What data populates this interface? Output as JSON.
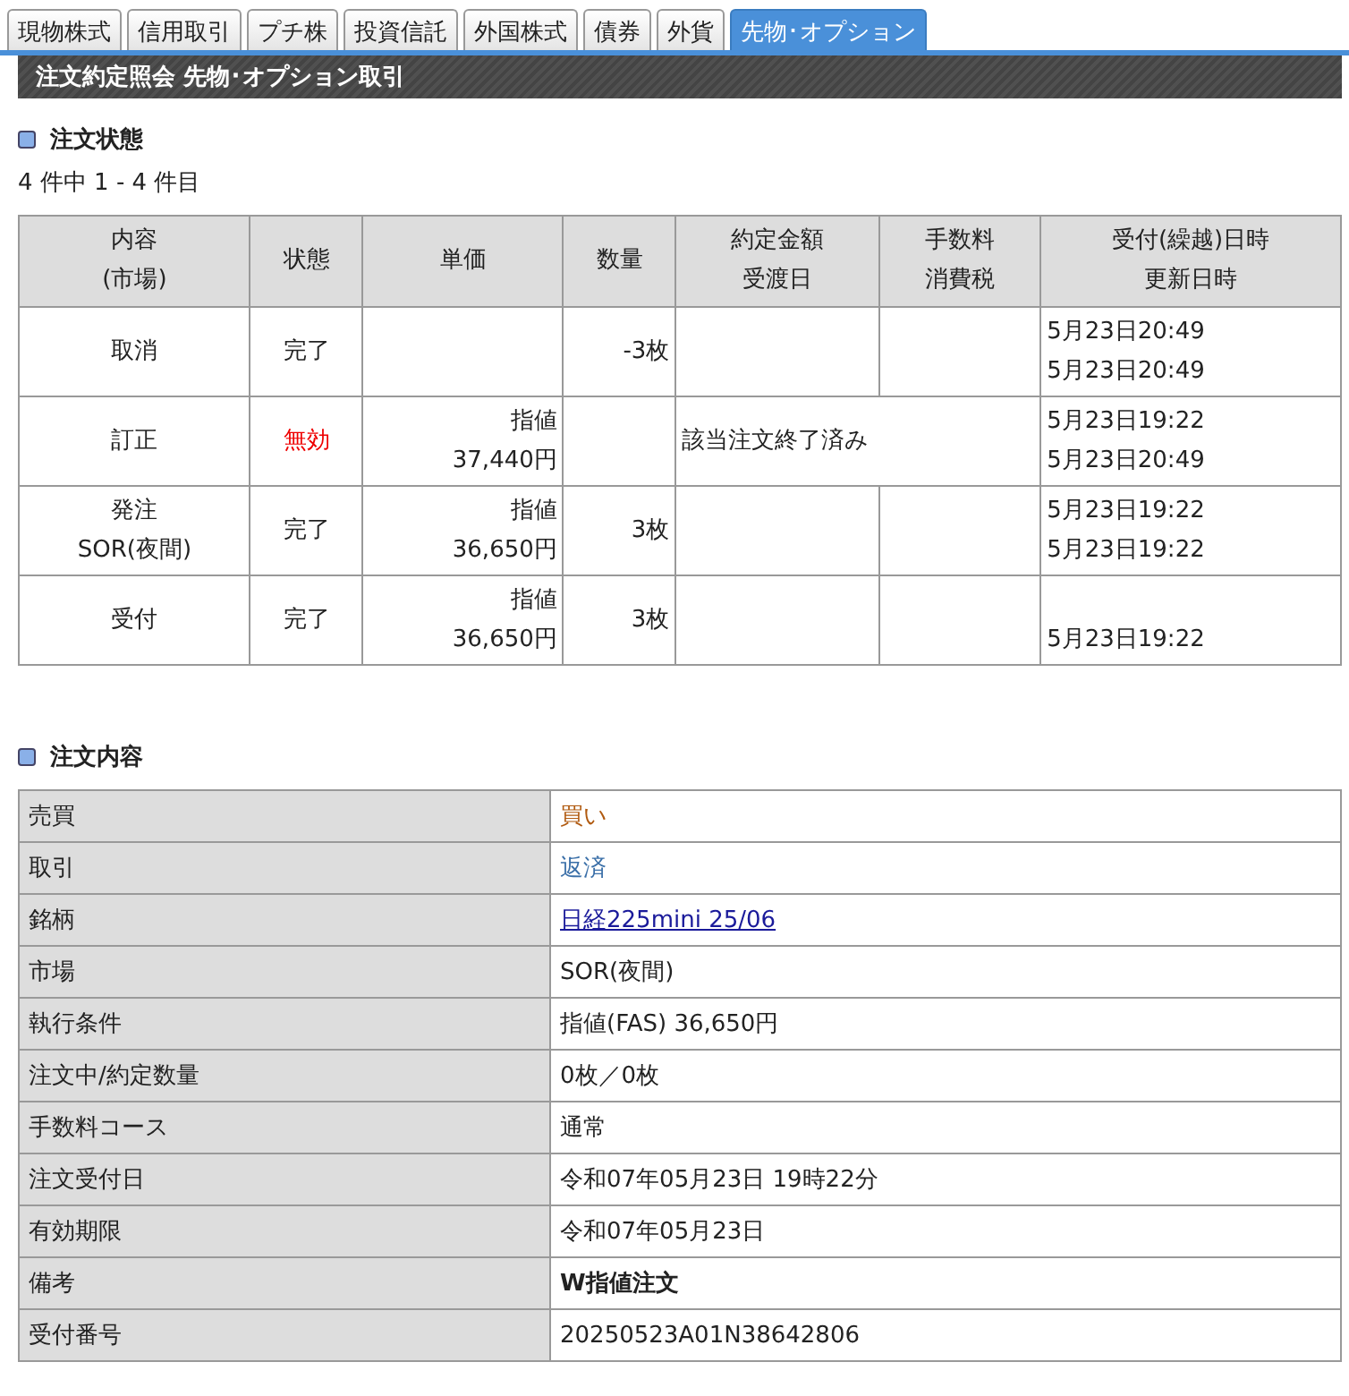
{
  "tabs": [
    {
      "label": "現物株式",
      "selected": false
    },
    {
      "label": "信用取引",
      "selected": false
    },
    {
      "label": "プチ株",
      "selected": false
    },
    {
      "label": "投資信託",
      "selected": false
    },
    {
      "label": "外国株式",
      "selected": false
    },
    {
      "label": "債券",
      "selected": false
    },
    {
      "label": "外貨",
      "selected": false
    },
    {
      "label": "先物･オプション",
      "selected": true
    }
  ],
  "page_title": "注文約定照会 先物･オプション取引",
  "order_status": {
    "heading": "注文状態",
    "count": "4 件中 1 - 4 件目",
    "columns": [
      [
        "内容",
        "(市場)"
      ],
      [
        "状態"
      ],
      [
        "単価"
      ],
      [
        "数量"
      ],
      [
        "約定金額",
        "受渡日"
      ],
      [
        "手数料",
        "消費税"
      ],
      [
        "受付(繰越)日時",
        "更新日時"
      ]
    ],
    "rows": [
      {
        "content": [
          "取消"
        ],
        "status": {
          "text": "完了",
          "kind": "done"
        },
        "price": [],
        "quantity": "-3枚",
        "received": "5月23日20:49",
        "updated": "5月23日20:49"
      },
      {
        "content": [
          "訂正"
        ],
        "status": {
          "text": "無効",
          "kind": "invalid"
        },
        "price": [
          "指値",
          "37,440円"
        ],
        "note": "該当注文終了済み",
        "received": "5月23日19:22",
        "updated": "5月23日20:49"
      },
      {
        "content": [
          "発注",
          "SOR(夜間)"
        ],
        "status": {
          "text": "完了",
          "kind": "done"
        },
        "price": [
          "指値",
          "36,650円"
        ],
        "quantity": "3枚",
        "received": "5月23日19:22",
        "updated": "5月23日19:22"
      },
      {
        "content": [
          "受付"
        ],
        "status": {
          "text": "完了",
          "kind": "done"
        },
        "price": [
          "指値",
          "36,650円"
        ],
        "quantity": "3枚",
        "updated": "5月23日19:22"
      }
    ]
  },
  "order_details": {
    "heading": "注文内容",
    "rows": [
      {
        "label": "売買",
        "value": "買い",
        "kind": "side"
      },
      {
        "label": "取引",
        "value": "返済",
        "kind": "trade"
      },
      {
        "label": "銘柄",
        "value": "日経225mini 25/06",
        "kind": "link"
      },
      {
        "label": "市場",
        "value": "SOR(夜間)",
        "kind": "plain"
      },
      {
        "label": "執行条件",
        "value": "指値(FAS) 36,650円",
        "kind": "plain"
      },
      {
        "label": "注文中/約定数量",
        "value": "0枚／0枚",
        "kind": "plain"
      },
      {
        "label": "手数料コース",
        "value": "通常",
        "kind": "plain"
      },
      {
        "label": "注文受付日",
        "value": "令和07年05月23日 19時22分",
        "kind": "plain"
      },
      {
        "label": "有効期限",
        "value": "令和07年05月23日",
        "kind": "plain"
      },
      {
        "label": "備考",
        "value": "W指値注文",
        "kind": "bold"
      },
      {
        "label": "受付番号",
        "value": "20250523A01N38642806",
        "kind": "plain"
      }
    ]
  }
}
